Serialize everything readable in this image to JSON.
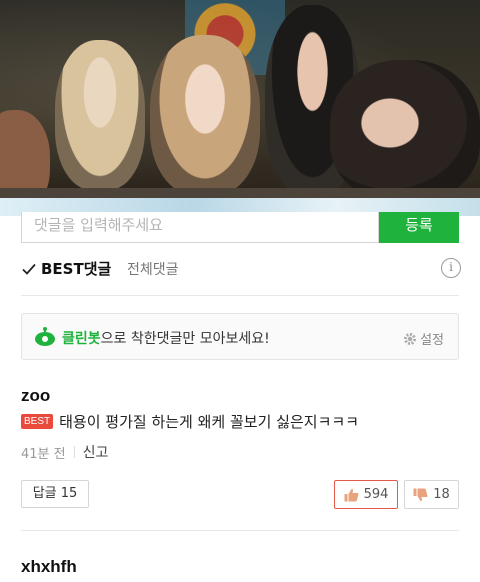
{
  "comment_input": {
    "placeholder": "댓글을 입력해주세요",
    "submit_label": "등록"
  },
  "tabs": {
    "best_label": "BEST댓글",
    "all_label": "전체댓글",
    "info_symbol": "i"
  },
  "cleanbot": {
    "highlight": "클린봇",
    "message": "으로 착한댓글만 모아보세요!",
    "settings_label": "설정"
  },
  "comments": [
    {
      "username": "zoo",
      "badge": "BEST",
      "text": "태용이 평가질 하는게 왜케 꼴보기 싫은지ㅋㅋㅋ",
      "time": "41분 전",
      "report_label": "신고",
      "reply_label": "답글 15",
      "likes": "594",
      "dislikes": "18"
    },
    {
      "username": "xhxhfh"
    }
  ],
  "colors": {
    "accent_green": "#1fb33e",
    "best_red": "#ea4a3c",
    "like_border": "#e35a4a"
  }
}
